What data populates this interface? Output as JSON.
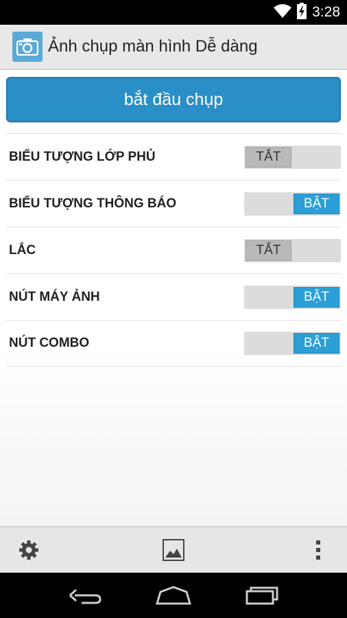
{
  "status_bar": {
    "time": "3:28",
    "icons": [
      "wifi-icon",
      "battery-charging-icon"
    ]
  },
  "action_bar": {
    "title": "Ảnh chụp màn hình Dễ dàng",
    "icon": "camera-icon"
  },
  "capture_button": {
    "label": "bắt đầu chụp"
  },
  "settings": [
    {
      "label": "BIỂU TƯỢNG LỚP PHỦ",
      "state": "off",
      "toggle_text": "TẮT"
    },
    {
      "label": "BIỂU TƯỢNG THÔNG BÁO",
      "state": "on",
      "toggle_text": "BẬT"
    },
    {
      "label": "LẮC",
      "state": "off",
      "toggle_text": "TẮT"
    },
    {
      "label": "NÚT MÁY ẢNH",
      "state": "on",
      "toggle_text": "BẬT"
    },
    {
      "label": "NÚT COMBO",
      "state": "on",
      "toggle_text": "BẬT"
    }
  ],
  "bottom_toolbar": {
    "icons": [
      "settings-gear-icon",
      "gallery-image-icon",
      "overflow-menu-icon"
    ]
  },
  "nav_bar": {
    "icons": [
      "back-icon",
      "home-icon",
      "recent-apps-icon"
    ]
  },
  "colors": {
    "accent": "#2a8fc6",
    "toggle_on": "#2b9fd6",
    "toggle_off": "#b9b9b9"
  }
}
